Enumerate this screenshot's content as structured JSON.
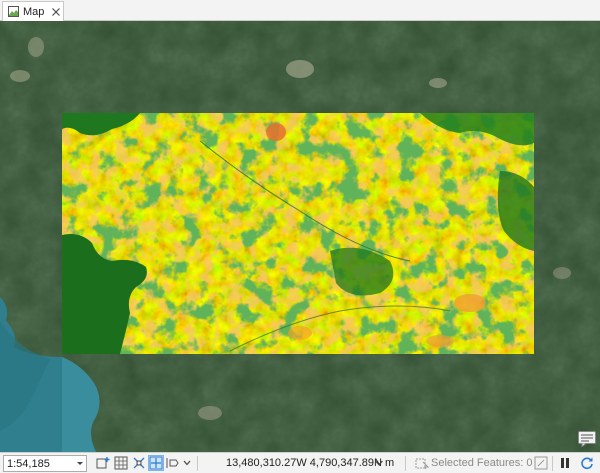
{
  "tab": {
    "label": "Map",
    "icon": "map-icon",
    "close_icon": "close-icon"
  },
  "statusbar": {
    "scale_value": "1:54,185",
    "coordinates": "13,480,310.27W 4,790,347.89N m",
    "selected_features": "Selected Features: 0",
    "icons": [
      "add-layer-icon",
      "grid-icon",
      "fixed-zoom-icon",
      "map-navigation-icon",
      "pan-icon",
      "nav-dropdown-icon",
      "coordinate-units-dropdown-icon",
      "selection-icon",
      "table-icon",
      "pause-icon",
      "refresh-icon"
    ]
  },
  "colors": {
    "tab_bg": "#ffffff",
    "bar_bg": "#f3f3f3",
    "accent": "#0a64c8",
    "raster_green": "#1f7a1f",
    "raster_yellow": "#ffff00",
    "raster_orange": "#f2a12a",
    "raster_red": "#e0562e",
    "water": "#3c8a99"
  }
}
